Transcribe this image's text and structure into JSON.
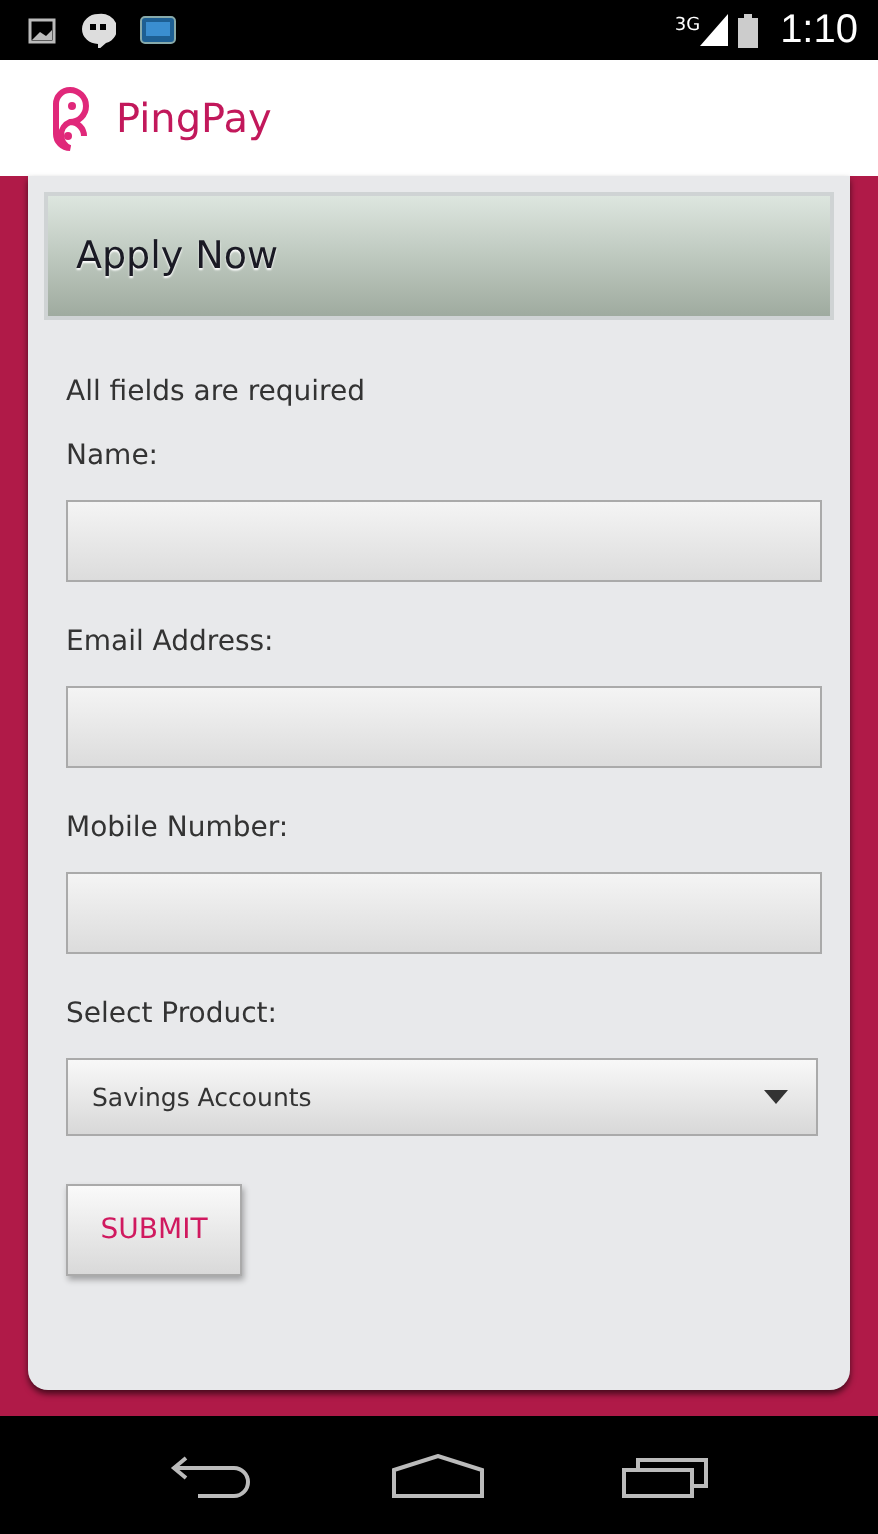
{
  "status_bar": {
    "network": "3G",
    "time": "1:10"
  },
  "app_bar": {
    "title": "PingPay"
  },
  "form": {
    "title": "Apply Now",
    "note": "All fields are required",
    "fields": [
      {
        "kind": "text",
        "label": "Name:"
      },
      {
        "kind": "text",
        "label": "Email Address:"
      },
      {
        "kind": "text",
        "label": "Mobile Number:"
      },
      {
        "kind": "select",
        "label": "Select Product:",
        "value": "Savings Accounts"
      }
    ],
    "submit": "SUBMIT"
  }
}
